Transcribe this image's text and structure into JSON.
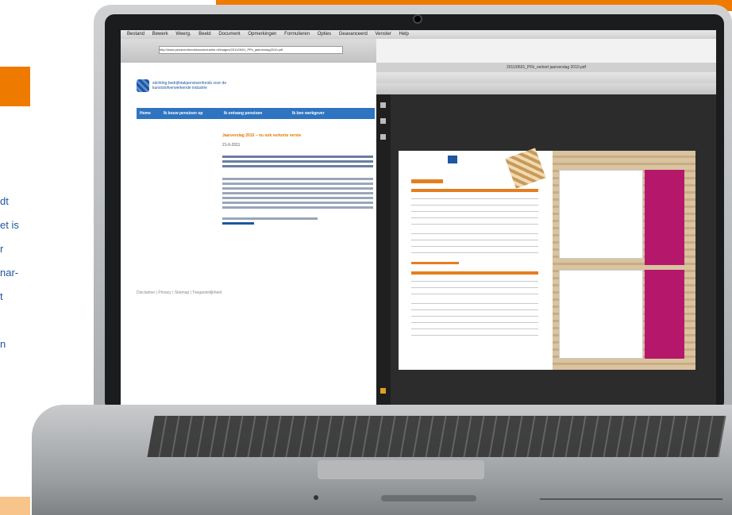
{
  "left_text": {
    "lines": [
      "dt",
      "et is",
      "r",
      "nar-",
      "t",
      "",
      "n"
    ]
  },
  "colors": {
    "brand_orange": "#ef7a00",
    "brand_blue": "#1e56a0",
    "pdf_pink": "#b5176b"
  },
  "screen": {
    "menubar": [
      "Bestand",
      "Bewerk",
      "Weerg.",
      "Beeld",
      "Document",
      "Opmerkingen",
      "Formulieren",
      "Opties",
      "Geavanceerd",
      "Venster",
      "Help"
    ],
    "url": "http://www.pensioenfondsbouwindustrie.nl/images/2011/0601_PFb_jaarverslag2010.pdf",
    "site": {
      "name": "stichting bedrijfstakpensioenfonds voor de kunststofverwerkende industrie",
      "nav": [
        "Home",
        "Ik bouw pensioen op",
        "Ik ontvang pensioen",
        "Ik ben werkgever"
      ],
      "article_title": "Jaarverslag 2010 – nu ook verkorte versie",
      "article_date": "21-6-2011",
      "footer": "Disclaimer | Privacy | Sitemap | Toegankelijkheid"
    },
    "pdf": {
      "title": "2011/0601_PFb_verkort jaarverslag 2010.pdf"
    }
  }
}
